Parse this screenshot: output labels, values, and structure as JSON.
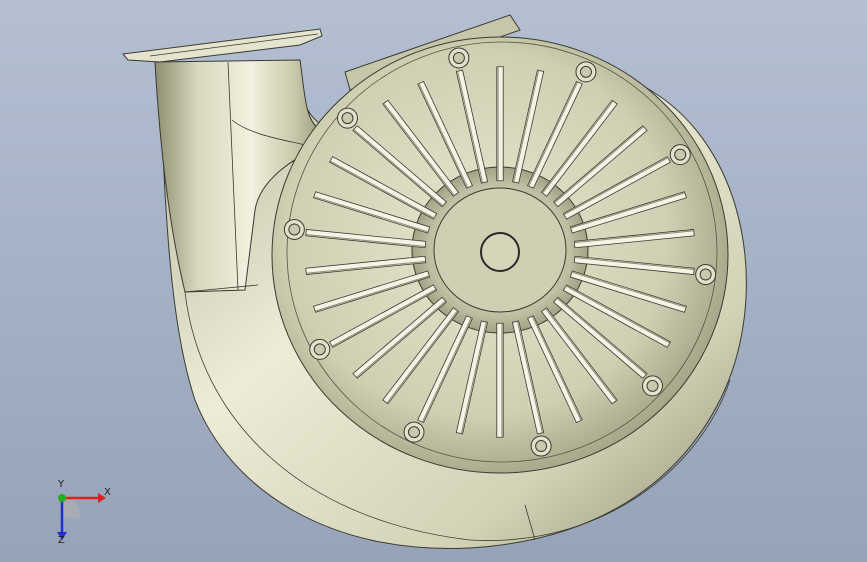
{
  "viewport": {
    "background_top": "#b4bfd2",
    "background_bottom": "#96a3b8"
  },
  "model": {
    "surface_color": "#d3d3b8",
    "shade_color": "#a9a98c",
    "edge_color": "#3a3a30",
    "fan_slots": 30,
    "bolts": 10
  },
  "triad": {
    "x_label": "X",
    "y_label": "Y",
    "z_label": "Z",
    "x_color": "#e02020",
    "y_color": "#20b020",
    "z_color": "#2030d0"
  }
}
